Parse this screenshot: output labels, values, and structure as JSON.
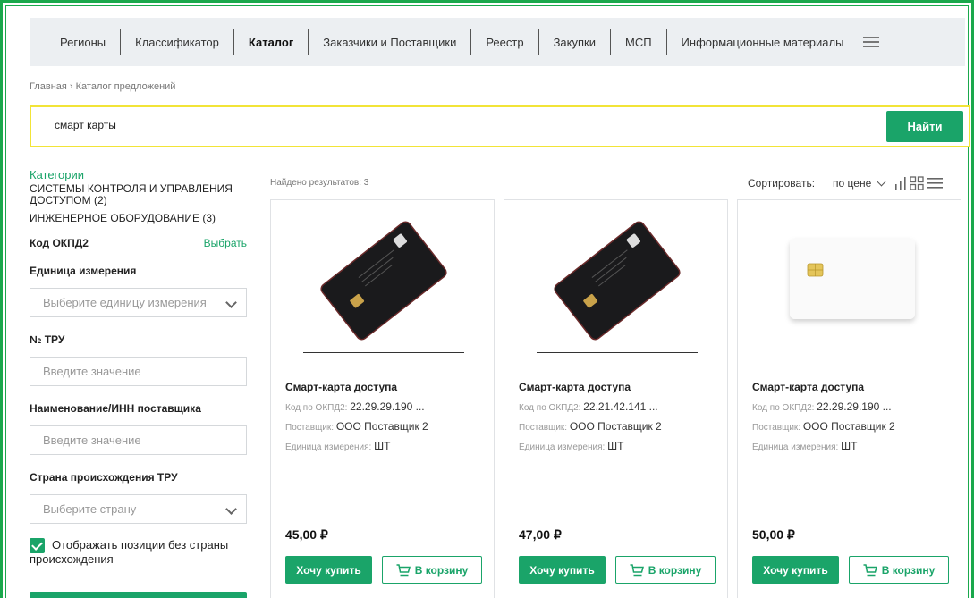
{
  "nav": {
    "items": [
      {
        "label": "Регионы",
        "active": false
      },
      {
        "label": "Классификатор",
        "active": false
      },
      {
        "label": "Каталог",
        "active": true
      },
      {
        "label": "Заказчики и Поставщики",
        "active": false
      },
      {
        "label": "Реестр",
        "active": false
      },
      {
        "label": "Закупки",
        "active": false
      },
      {
        "label": "МСП",
        "active": false
      },
      {
        "label": "Информационные материалы",
        "active": false
      }
    ],
    "menu_icon": "hamburger-icon"
  },
  "breadcrumb": "Главная › Каталог предложений",
  "search": {
    "value": "смарт карты",
    "button_label": "Найти",
    "border_color": "#f2e437"
  },
  "sidebar": {
    "categories_heading": "Категории",
    "categories": [
      {
        "label": "СИСТЕМЫ КОНТРОЛЯ И УПРАВЛЕНИЯ ДОСТУПОМ (2)"
      },
      {
        "label": "ИНЖЕНЕРНОЕ ОБОРУДОВАНИЕ (3)"
      }
    ],
    "okpd_label": "Код ОКПД2",
    "okpd_action": "Выбрать",
    "unit_label": "Единица измерения",
    "unit_placeholder": "Выберите единицу измерения",
    "tru_label": "№ ТРУ",
    "tru_placeholder": "Введите значение",
    "supplier_label": "Наименование/ИНН поставщика",
    "supplier_placeholder": "Введите значение",
    "country_label": "Страна происхождения ТРУ",
    "country_placeholder": "Выберите страну",
    "show_no_country_label": "Отображать позиции без страны происхождения",
    "show_no_country_checked": true
  },
  "results": {
    "found_text": "Найдено результатов: 3",
    "sort_label": "Сортировать:",
    "sort_value": "по цене"
  },
  "cards": [
    {
      "title": "Смарт-карта доступа",
      "okpd_label": "Код по ОКПД2:",
      "okpd_value": "22.29.29.190 ...",
      "supplier_label": "Поставщик:",
      "supplier_value": "ООО Поставщик 2",
      "unit_label": "Единица измерения:",
      "unit_value": "ШТ",
      "price": "45,00 ₽",
      "buy_label": "Хочу купить",
      "cart_label": "В корзину",
      "image": "black-card"
    },
    {
      "title": "Смарт-карта доступа",
      "okpd_label": "Код по ОКПД2:",
      "okpd_value": "22.21.42.141 ...",
      "supplier_label": "Поставщик:",
      "supplier_value": "ООО Поставщик 2",
      "unit_label": "Единица измерения:",
      "unit_value": "ШТ",
      "price": "47,00 ₽",
      "buy_label": "Хочу купить",
      "cart_label": "В корзину",
      "image": "black-card"
    },
    {
      "title": "Смарт-карта доступа",
      "okpd_label": "Код по ОКПД2:",
      "okpd_value": "22.29.29.190 ...",
      "supplier_label": "Поставщик:",
      "supplier_value": "ООО Поставщик 2",
      "unit_label": "Единица измерения:",
      "unit_value": "ШТ",
      "price": "50,00 ₽",
      "buy_label": "Хочу купить",
      "cart_label": "В корзину",
      "image": "white-chip-card"
    }
  ],
  "colors": {
    "accent": "#1aa469",
    "frame": "#1aa84c",
    "nav_bg": "#eceff2"
  }
}
